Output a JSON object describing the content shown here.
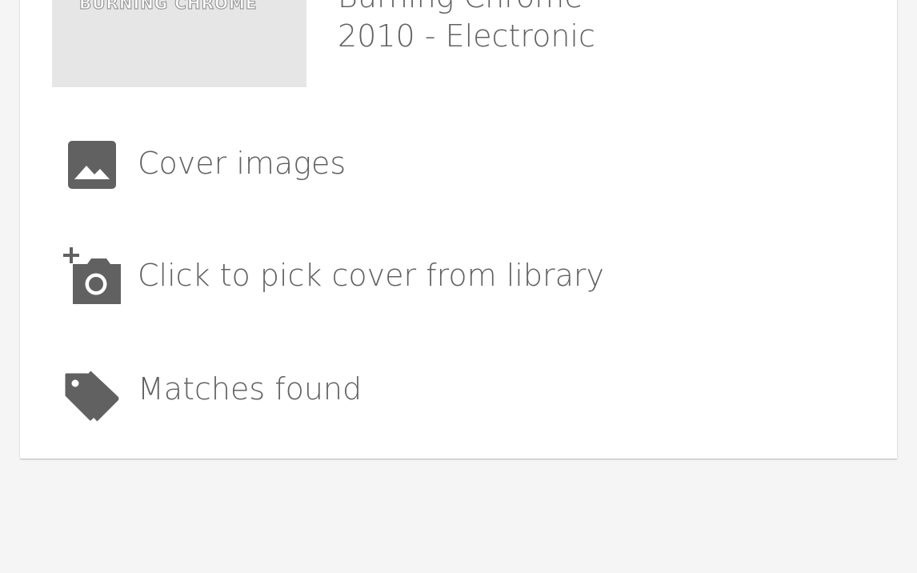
{
  "album": {
    "cover_text": "BURNING CHROME",
    "title": "Burning Chrome",
    "year_genre": "2010 - Electronic"
  },
  "actions": [
    {
      "label": "Cover images",
      "icon": "image-icon"
    },
    {
      "label": "Click to pick cover from library",
      "icon": "add-photo-icon"
    },
    {
      "label": "Matches found",
      "icon": "tags-icon"
    }
  ],
  "colors": {
    "background": "#f5f5f5",
    "card": "#ffffff",
    "icon": "#616161",
    "text": "#616161"
  }
}
